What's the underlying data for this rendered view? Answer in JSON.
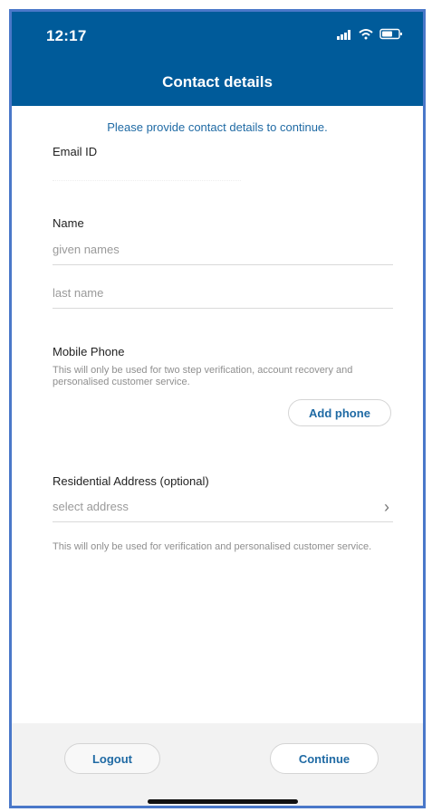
{
  "status_bar": {
    "time": "12:17",
    "icons": [
      "signal-icon",
      "wifi-icon",
      "battery-icon"
    ]
  },
  "header": {
    "title": "Contact details"
  },
  "form": {
    "prompt": "Please provide contact details to continue.",
    "email_label": "Email ID",
    "name_label": "Name",
    "given_names_placeholder": "given names",
    "last_name_placeholder": "last name",
    "mobile_label": "Mobile Phone",
    "mobile_help": "This will only be used for two step verification, account recovery and personalised customer service.",
    "add_phone_label": "Add phone",
    "address_label": "Residential Address (optional)",
    "address_placeholder": "select address",
    "address_help": "This will only be used for verification and personalised customer service."
  },
  "actions": {
    "logout_label": "Logout",
    "continue_label": "Continue"
  },
  "colors": {
    "header_bg": "#005b9a",
    "accent": "#1f6aa4",
    "frame_border": "#4a78c9"
  }
}
